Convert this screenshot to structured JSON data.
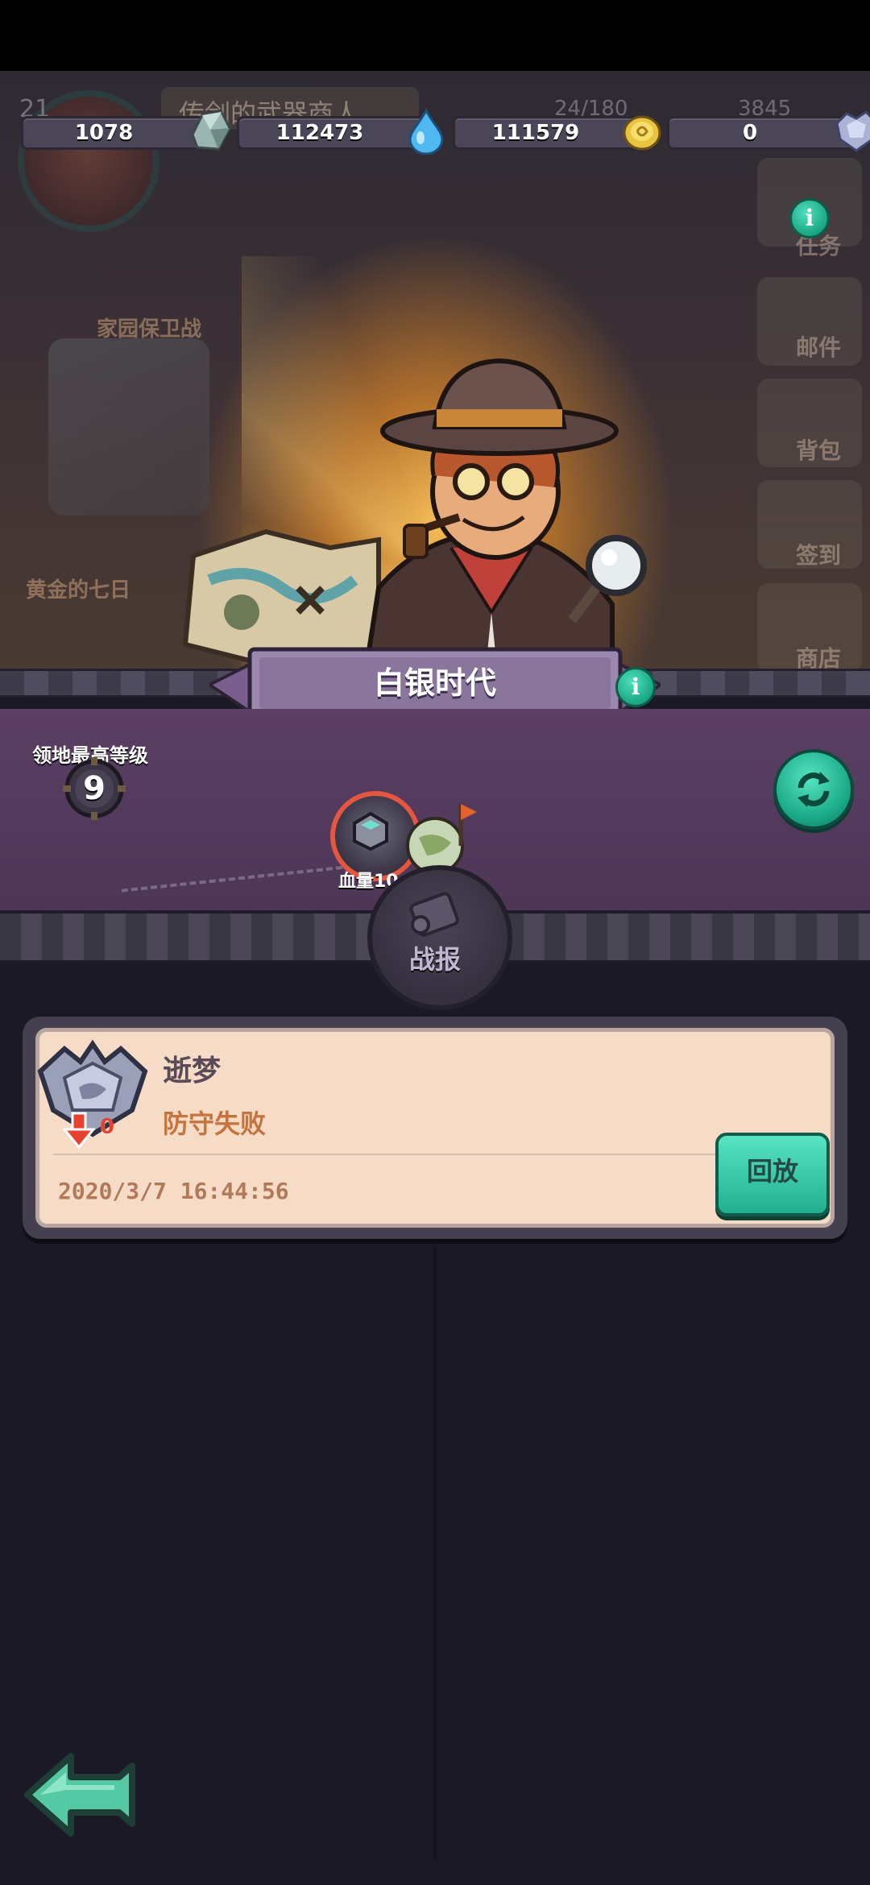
{
  "background": {
    "player_level": "21",
    "banner_text": "传剑的武器商人",
    "energy": "24/180",
    "extra_value": "3845",
    "left_labels": [
      "家园保卫战",
      "黄金的七日"
    ],
    "side_buttons": [
      "任务",
      "邮件",
      "背包",
      "签到",
      "商店"
    ]
  },
  "resources": [
    {
      "name": "ore",
      "value": "1078",
      "icon": "ore-crystal-icon"
    },
    {
      "name": "water",
      "value": "112473",
      "icon": "water-drop-icon"
    },
    {
      "name": "gold",
      "value": "111579",
      "icon": "gold-coin-icon"
    },
    {
      "name": "silver",
      "value": "0",
      "icon": "silver-badge-icon"
    }
  ],
  "era": {
    "title": "白银时代"
  },
  "territory": {
    "label": "领地最高等级",
    "level": "9",
    "node_label": "血量10"
  },
  "report_button": {
    "label": "战报"
  },
  "battle_report": {
    "player_name": "逝梦",
    "result": "防守失败",
    "rank_delta": "0",
    "timestamp": "2020/3/7 16:44:56",
    "replay_label": "回放"
  },
  "colors": {
    "accent_green": "#21b08f",
    "card_bg": "#f6dcc6",
    "result_text": "#c5743e",
    "loss_red": "#e8412f"
  }
}
